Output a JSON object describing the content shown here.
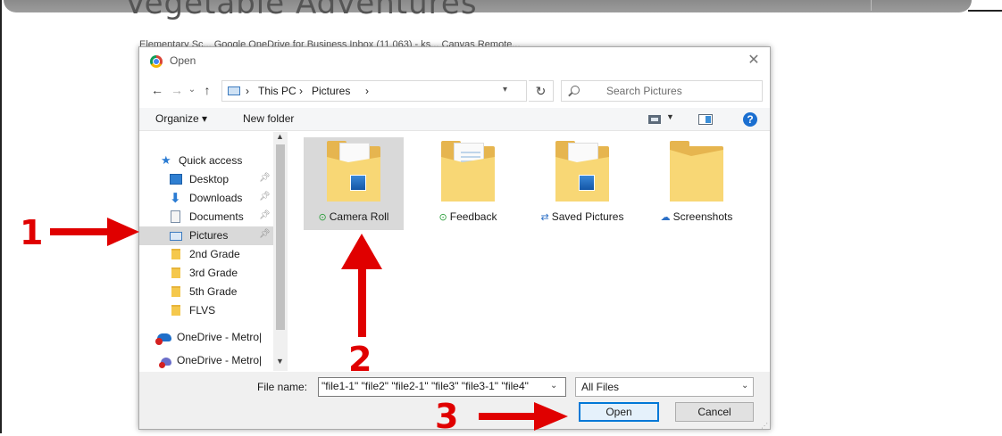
{
  "background": {
    "site_title": "Vegetable Adventures",
    "bookmarks": "Elementary Sc...   Google   OneDrive for Business   Inbox (11,063) - ks...   Canvas Remote..."
  },
  "dialog": {
    "title": "Open",
    "close": "✕",
    "address": {
      "crumbs": [
        "This PC",
        "Pictures"
      ],
      "separator": "›"
    },
    "search_placeholder": "Search Pictures",
    "toolbar": {
      "organize": "Organize ▾",
      "new_folder": "New folder"
    },
    "nav_items": [
      {
        "label": "Quick access",
        "icon": "star-icon"
      },
      {
        "label": "Desktop",
        "icon": "desktop-icon",
        "pinned": true
      },
      {
        "label": "Downloads",
        "icon": "download-icon",
        "pinned": true
      },
      {
        "label": "Documents",
        "icon": "documents-icon",
        "pinned": true
      },
      {
        "label": "Pictures",
        "icon": "pictures-icon",
        "pinned": true,
        "selected": true
      },
      {
        "label": "2nd Grade",
        "icon": "folder-icon"
      },
      {
        "label": "3rd Grade",
        "icon": "folder-icon"
      },
      {
        "label": "5th Grade",
        "icon": "folder-icon"
      },
      {
        "label": "FLVS",
        "icon": "folder-icon"
      },
      {
        "label": "OneDrive - Metro|",
        "icon": "onedrive-icon"
      },
      {
        "label": "OneDrive - Metro|",
        "icon": "onedrive-icon"
      }
    ],
    "folders": [
      {
        "name": "Camera Roll",
        "status": "⊙",
        "status_type": "synced",
        "selected": true
      },
      {
        "name": "Feedback",
        "status": "⊙",
        "status_type": "synced"
      },
      {
        "name": "Saved Pictures",
        "status": "⇄",
        "status_type": "syncing"
      },
      {
        "name": "Screenshots",
        "status": "☁",
        "status_type": "cloud"
      }
    ],
    "file_name_label": "File name:",
    "file_name_value": "\"file1-1\" \"file2\" \"file2-1\" \"file3\" \"file3-1\" \"file4\"",
    "file_type": "All Files",
    "open_label": "Open",
    "cancel_label": "Cancel"
  },
  "annotations": [
    "1",
    "2",
    "3"
  ],
  "colors": {
    "accent": "#0078d7",
    "annotation": "#e00000",
    "selection": "#d9d9d9"
  }
}
